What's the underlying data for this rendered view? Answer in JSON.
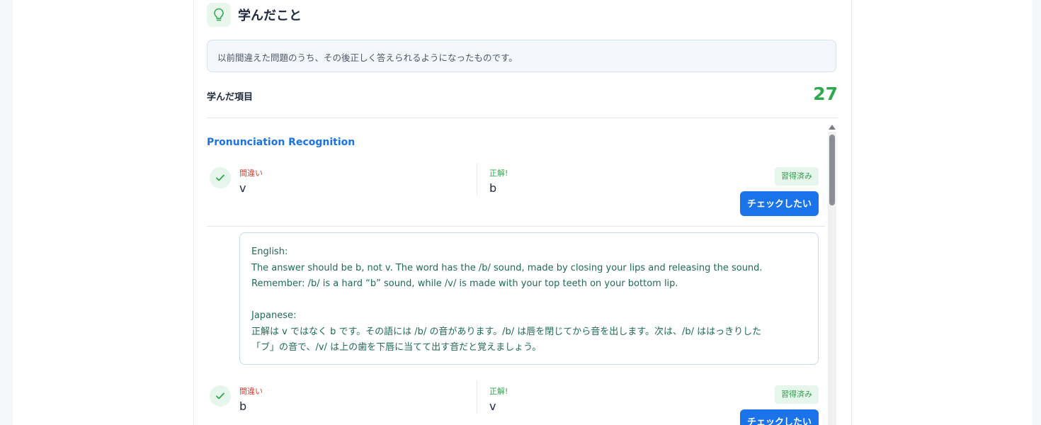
{
  "header": {
    "title": "学んだこと",
    "icon": "lightbulb-icon"
  },
  "info": "以前間違えた問題のうち、その後正しく答えられるようになったものです。",
  "summary": {
    "label": "学んだ項目",
    "count": "27"
  },
  "section": {
    "title": "Pronunciation Recognition"
  },
  "entries": [
    {
      "wrong_label": "間違い",
      "wrong_value": "v",
      "right_label": "正解!",
      "right_value": "b",
      "badge": "習得済み",
      "button": "チェックしたい"
    },
    {
      "wrong_label": "間違い",
      "wrong_value": "b",
      "right_label": "正解!",
      "right_value": "v",
      "badge": "習得済み",
      "button": "チェックしたい"
    }
  ],
  "explanation": {
    "en_heading": "English:",
    "en_line1": "The answer should be b, not v. The word has the /b/ sound, made by closing your lips and releasing the sound.",
    "en_line2": "Remember: /b/ is a hard “b” sound, while /v/ is made with your top teeth on your bottom lip.",
    "ja_heading": "Japanese:",
    "ja_line1": "正解は v ではなく b です。その語には /b/ の音があります。/b/ は唇を閉じてから音を出します。次は、/b/ ははっきりした",
    "ja_line2": "「ブ」の音で、/v/ は上の歯を下唇に当てて出す音だと覚えましょう。"
  },
  "colors": {
    "accent_blue": "#1a73e8",
    "success_green": "#2fa84f",
    "error_red": "#d93a2e",
    "explanation_text": "#1f6a56"
  }
}
